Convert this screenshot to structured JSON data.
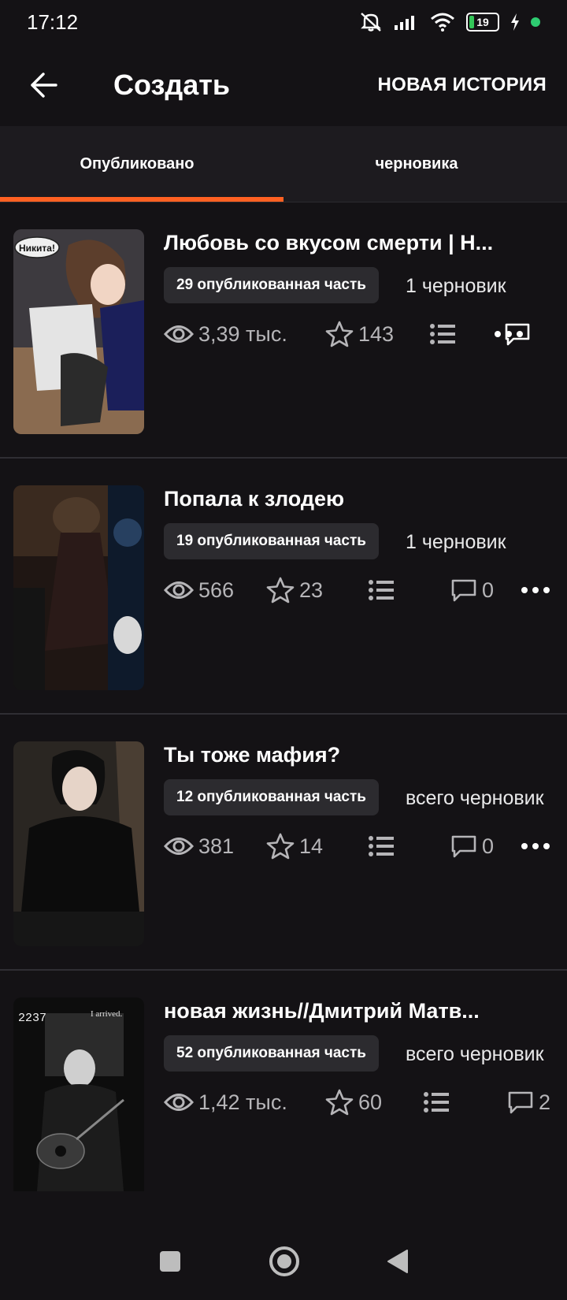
{
  "status_bar": {
    "time": "17:12",
    "battery": "19"
  },
  "header": {
    "title": "Создать",
    "new_story_label": "НОВАЯ ИСТОРИЯ"
  },
  "tabs": [
    {
      "label": "Опубликовано"
    },
    {
      "label": "черновика"
    }
  ],
  "stories": [
    {
      "title": "Любовь со вкусом смерти | Н...",
      "parts": "29 опубликованная часть",
      "drafts": "1 черновик",
      "views": "3,39 тыс.",
      "votes": "143",
      "comments": ""
    },
    {
      "title": "Попала к злодею",
      "parts": "19 опубликованная часть",
      "drafts": "1 черновик",
      "views": "566",
      "votes": "23",
      "comments": "0"
    },
    {
      "title": "Ты тоже мафия?",
      "parts": "12 опубликованная часть",
      "drafts": "всего черновик",
      "views": "381",
      "votes": "14",
      "comments": "0"
    },
    {
      "title": "новая жизнь//Дмитрий Матв...",
      "parts": "52 опубликованная часть",
      "drafts": "всего черновик",
      "views": "1,42 тыс.",
      "votes": "60",
      "comments": "2"
    }
  ],
  "covers": {
    "story1_bubble": "Никита!",
    "story4_number": "2237",
    "story4_caption": "I arrived."
  },
  "colors": {
    "accent": "#ff6122",
    "background": "#141215",
    "pill": "#2c2b2f"
  }
}
